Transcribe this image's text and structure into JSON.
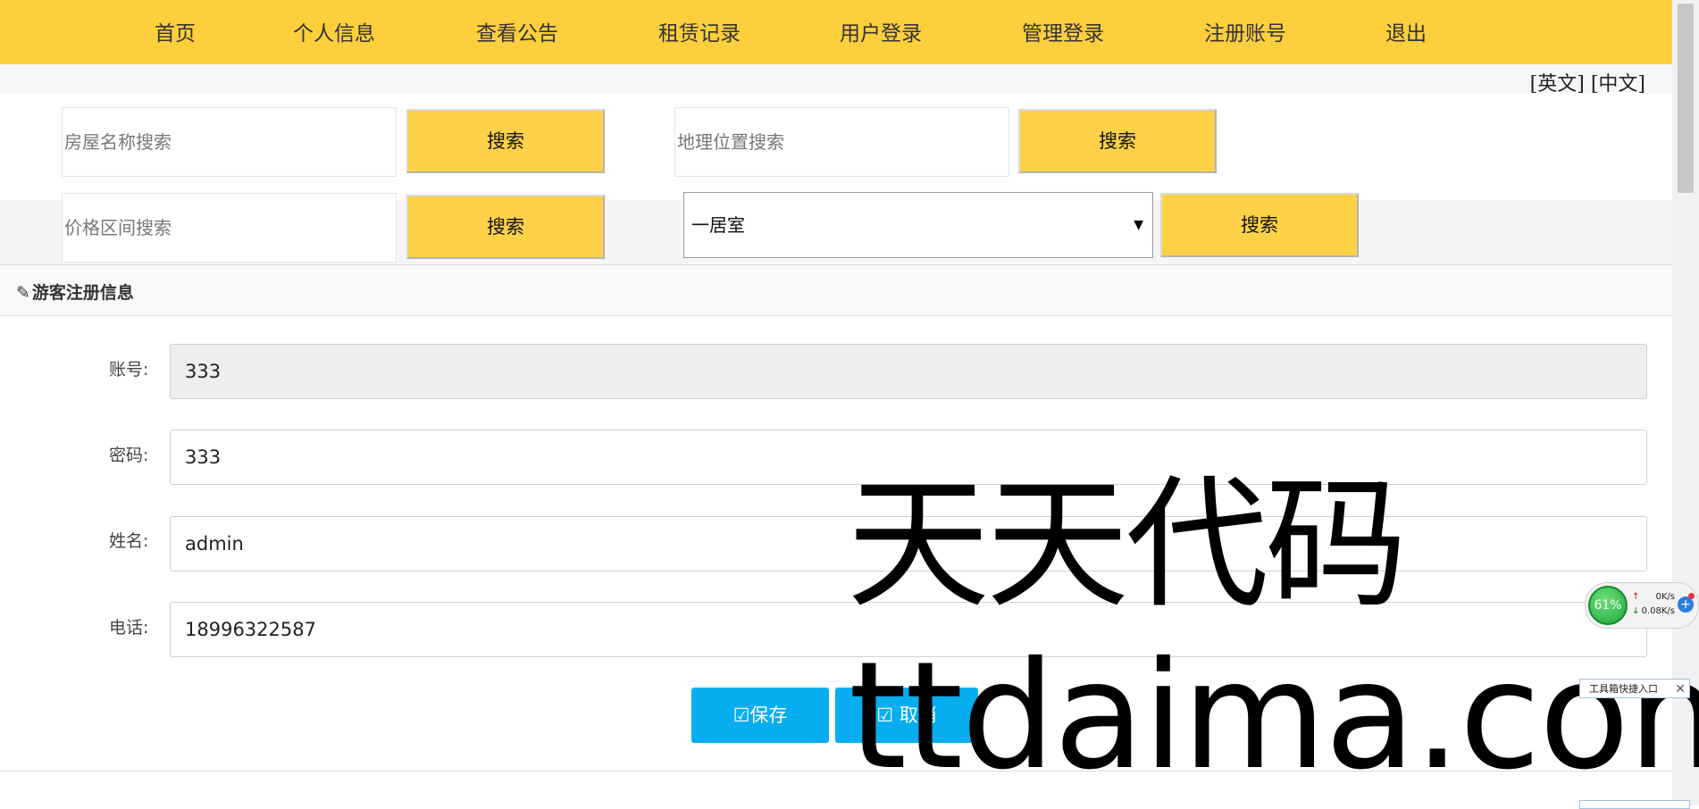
{
  "nav": {
    "items": [
      "首页",
      "个人信息",
      "查看公告",
      "租赁记录",
      "用户登录",
      "管理登录",
      "注册账号",
      "退出"
    ]
  },
  "lang": {
    "english": "[英文]",
    "chinese": "[中文]"
  },
  "search": {
    "house_name_placeholder": "房屋名称搜索",
    "location_placeholder": "地理位置搜索",
    "price_placeholder": "价格区间搜索",
    "button_label": "搜索",
    "room_type_selected": "一居室"
  },
  "panel": {
    "title": "游客注册信息",
    "fields": {
      "account_label": "账号:",
      "account_value": "333",
      "password_label": "密码:",
      "password_value": "333",
      "name_label": "姓名:",
      "name_value": "admin",
      "phone_label": "电话:",
      "phone_value": "18996322587"
    },
    "save_label": "保存",
    "cancel_label": "取消"
  },
  "watermark": {
    "line1": "天天代码",
    "line2": "ttdaima.com"
  },
  "widgets": {
    "cpu_percent": "61%",
    "upload": "0K/s",
    "download": "0.08K/s",
    "toolbox_label": "工具箱快捷入口"
  },
  "colors": {
    "nav_bg": "#fdcf3d",
    "search_button": "#fdd246",
    "action_button": "#06aeef"
  }
}
